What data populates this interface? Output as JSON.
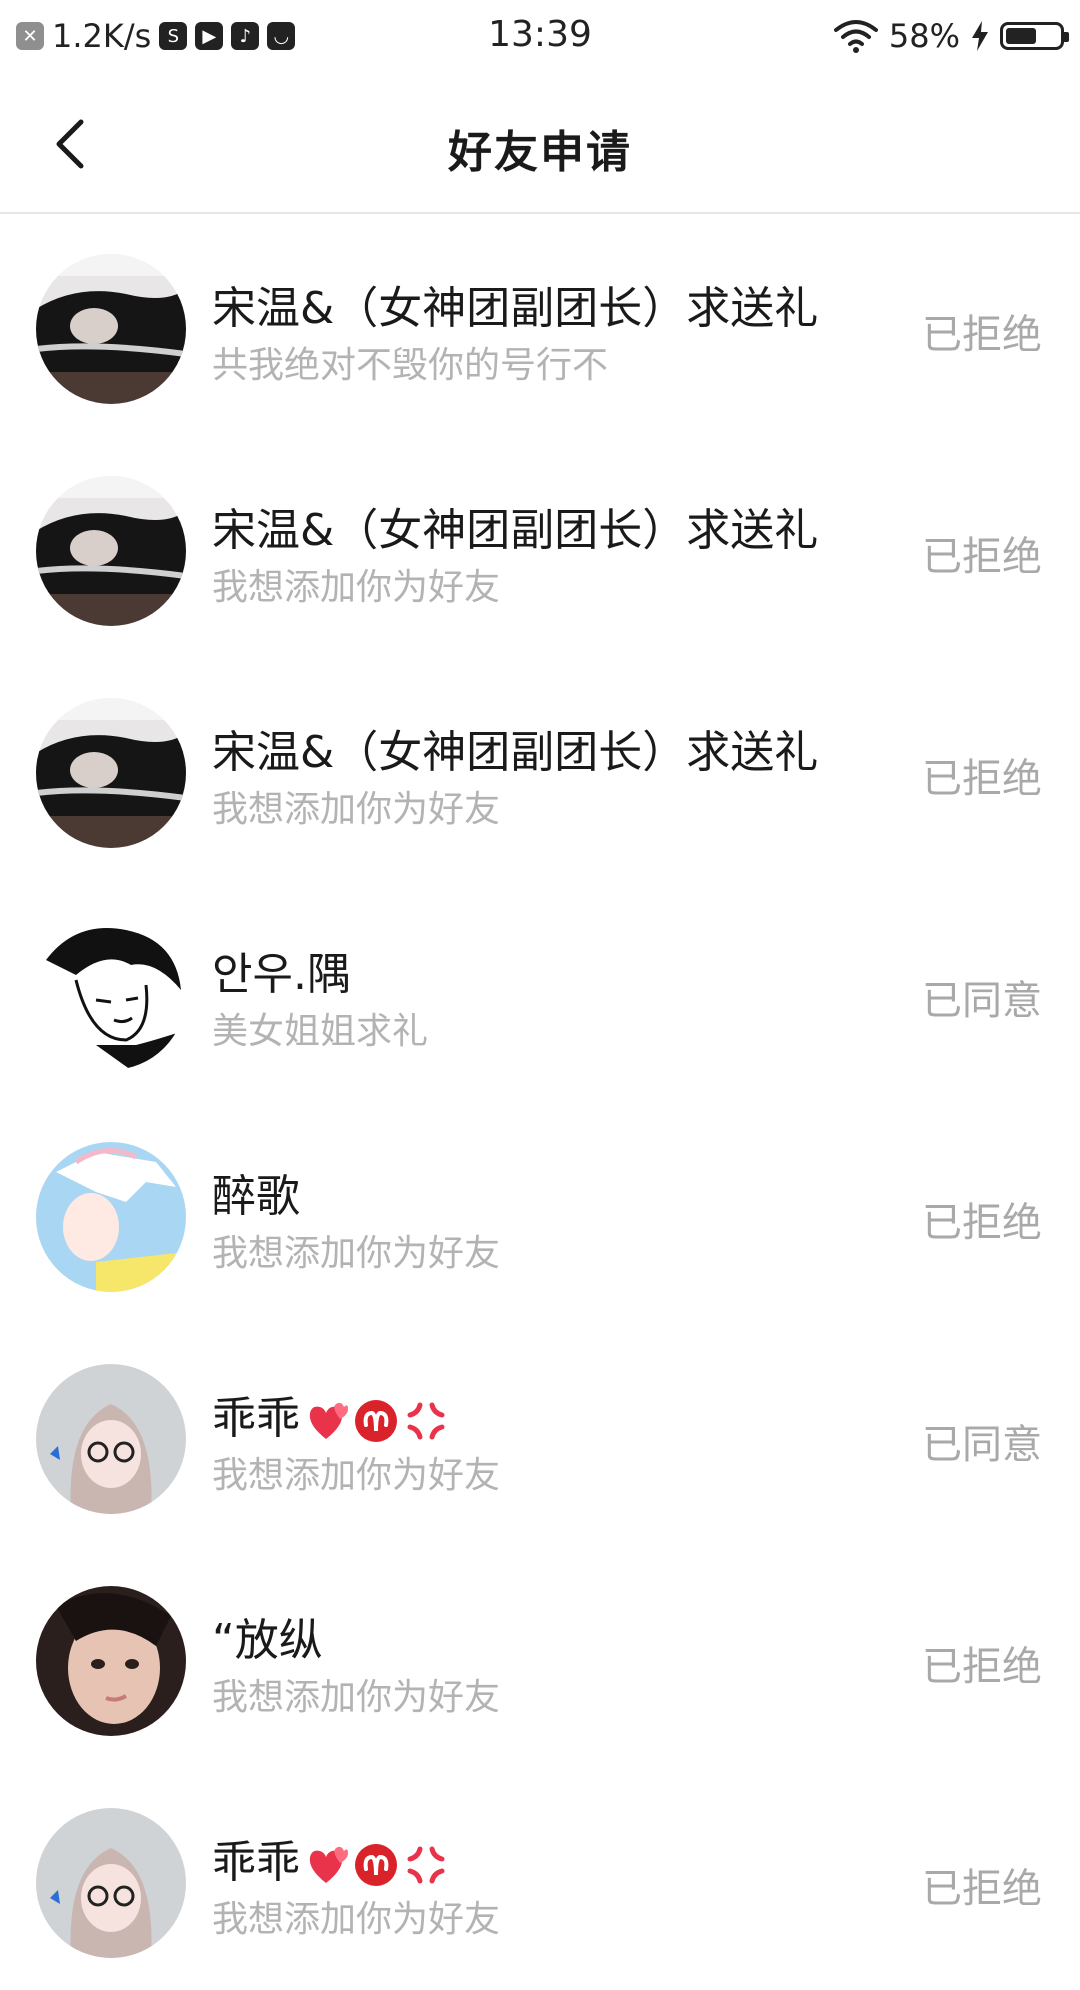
{
  "status_bar": {
    "net_speed": "1.2K/s",
    "time": "13:39",
    "battery_text": "58%",
    "battery_level": 0.58,
    "icons": [
      "notification-x-icon",
      "sim-icon",
      "media-icon",
      "music-icon",
      "inbox-icon"
    ]
  },
  "nav": {
    "title": "好友申请"
  },
  "requests": [
    {
      "name": "宋温&（女神团副团长）求送礼",
      "message": "共我绝对不毁你的号行不",
      "status": "已拒绝"
    },
    {
      "name": "宋温&（女神团副团长）求送礼",
      "message": "我想添加你为好友",
      "status": "已拒绝"
    },
    {
      "name": "宋温&（女神团副团长）求送礼",
      "message": "我想添加你为好友",
      "status": "已拒绝"
    },
    {
      "name": "안우.隅",
      "message": "美女姐姐求礼",
      "status": "已同意"
    },
    {
      "name": "醉歌",
      "message": "我想添加你为好友",
      "status": "已拒绝"
    },
    {
      "name": "乖乖",
      "message": "我想添加你为好友",
      "status": "已同意"
    },
    {
      "name": "“放纵",
      "message": "我想添加你为好友",
      "status": "已拒绝"
    },
    {
      "name": "乖乖",
      "message": "我想添加你为好友",
      "status": "已拒绝"
    }
  ]
}
